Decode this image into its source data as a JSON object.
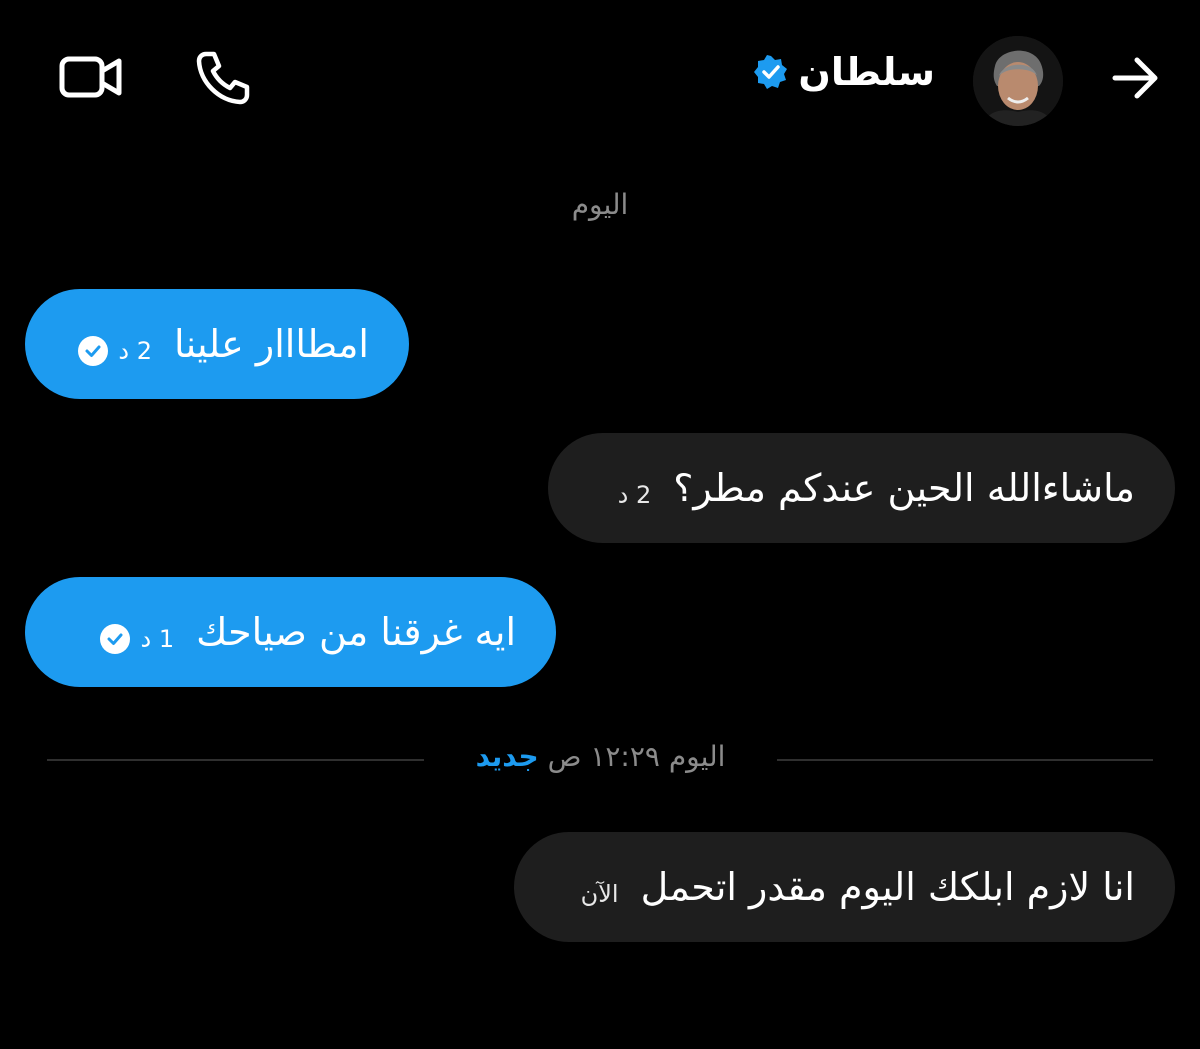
{
  "header": {
    "contact_name": "سلطان",
    "verified": true,
    "icons": [
      "back-arrow-icon",
      "video-call-icon",
      "phone-call-icon",
      "verified-badge-icon"
    ]
  },
  "day_label": "اليوم",
  "messages": [
    {
      "direction": "sent",
      "text": "امطااار علينا",
      "time": "2 د",
      "read": true
    },
    {
      "direction": "received",
      "text": "ماشاءالله الحين عندكم مطر؟",
      "time": "2 د"
    },
    {
      "direction": "sent",
      "text": "ايه غرقنا من  صياحك",
      "time": "1 د",
      "read": true
    },
    {
      "direction": "received",
      "text": "انا لازم ابلكك اليوم مقدر اتحمل",
      "time": "الآن"
    }
  ],
  "new_divider": {
    "time_text": "اليوم ١٢:٢٩ ص",
    "new_label": "جديد"
  },
  "colors": {
    "background": "#000000",
    "sent_bubble": "#1d9bf0",
    "received_bubble": "#1e1e1e",
    "accent": "#1d9bf0",
    "muted_text": "#8b8b8b"
  }
}
